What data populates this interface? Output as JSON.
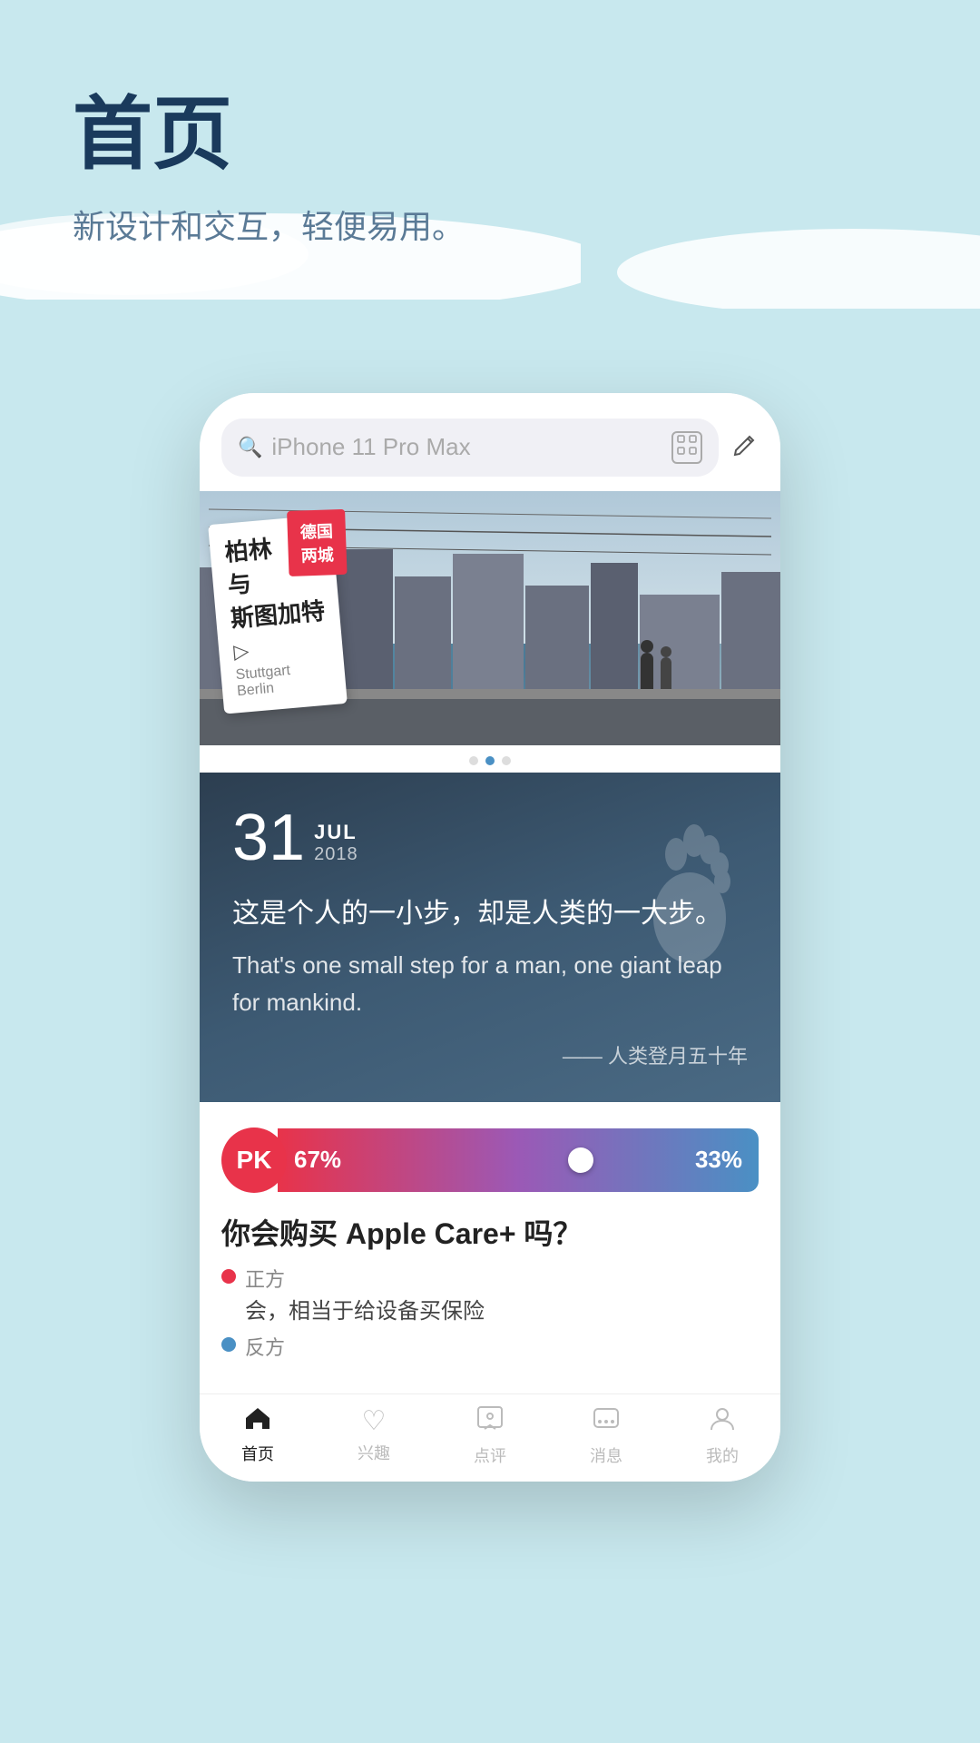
{
  "page": {
    "title": "首页",
    "subtitle": "新设计和交互，轻便易用。",
    "background_color": "#c8e8ee"
  },
  "search": {
    "placeholder": "iPhone 11 Pro Max",
    "scan_icon": "scan-icon",
    "edit_icon": "edit-icon"
  },
  "banner": {
    "card_title": "柏林\n与\n斯图加特",
    "card_tag": "德国\n两城",
    "card_sub": "Stuttgart\nBerlin",
    "dots": [
      false,
      true,
      false
    ]
  },
  "daily": {
    "date_num": "31",
    "month": "JUL",
    "year": "2018",
    "quote_cn": "这是个人的一小步，却是人类的一大步。",
    "quote_en": "That's one small step for a man, one giant leap for mankind.",
    "source": "—— 人类登月五十年"
  },
  "pk": {
    "badge": "PK",
    "left_pct": "67%",
    "right_pct": "33%",
    "question": "你会购买 Apple Care+ 吗？",
    "options": [
      {
        "side": "正方",
        "color": "red",
        "text": "会，相当于给设备买保险"
      },
      {
        "side": "反方",
        "color": "blue",
        "text": ""
      }
    ]
  },
  "tabs": [
    {
      "label": "首页",
      "icon": "🏠",
      "active": true
    },
    {
      "label": "兴趣",
      "icon": "♡",
      "active": false
    },
    {
      "label": "点评",
      "icon": "⭐",
      "active": false
    },
    {
      "label": "消息",
      "icon": "💬",
      "active": false
    },
    {
      "label": "我的",
      "icon": "👤",
      "active": false
    }
  ]
}
